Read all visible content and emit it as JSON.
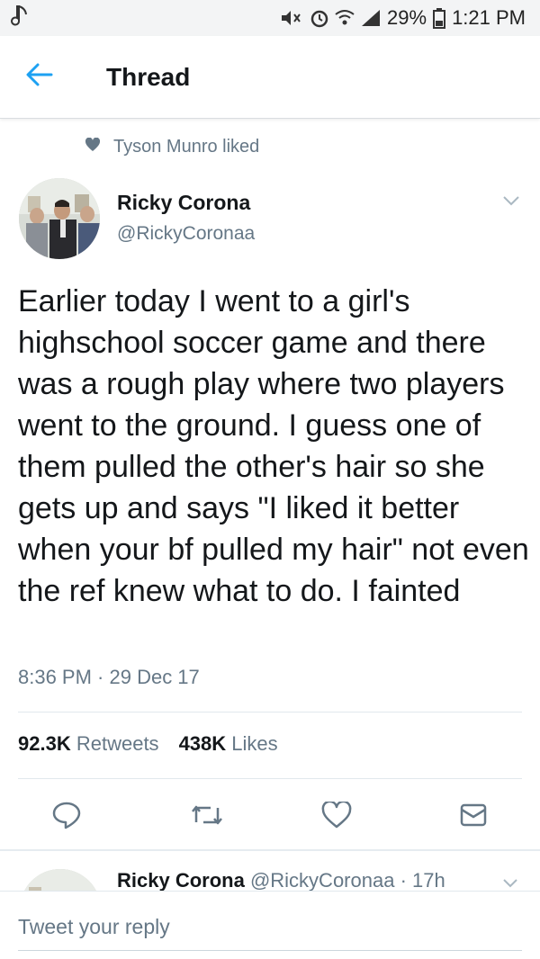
{
  "status_bar": {
    "battery": "29%",
    "time": "1:21 PM"
  },
  "header": {
    "title": "Thread"
  },
  "liked_by": "Tyson Munro liked",
  "tweet": {
    "author_name": "Ricky Corona",
    "author_handle": "@RickyCoronaa",
    "text": "Earlier today I went to a girl's highschool soccer game and there was a rough play where two players went to the ground. I guess one of them pulled the other's hair so she gets up and says \"I liked it better when your bf pulled my hair\" not even the ref knew what to do. I fainted",
    "timestamp": "8:36 PM · 29 Dec 17",
    "retweets_count": "92.3K",
    "retweets_label": "Retweets",
    "likes_count": "438K",
    "likes_label": "Likes"
  },
  "reply_preview": {
    "author_name": "Ricky Corona",
    "author_handle": "@RickyCoronaa",
    "age": "· 17h"
  },
  "composer": {
    "placeholder": "Tweet your reply"
  },
  "colors": {
    "accent": "#1da1f2",
    "secondary_text": "#657786",
    "primary_text": "#14171a"
  },
  "icons": [
    "music-note-icon",
    "mute-icon",
    "alarm-icon",
    "wifi-icon",
    "signal-icon",
    "battery-icon",
    "back-arrow-icon",
    "heart-icon",
    "chevron-down-icon",
    "reply-icon",
    "retweet-icon",
    "like-icon",
    "message-icon"
  ]
}
